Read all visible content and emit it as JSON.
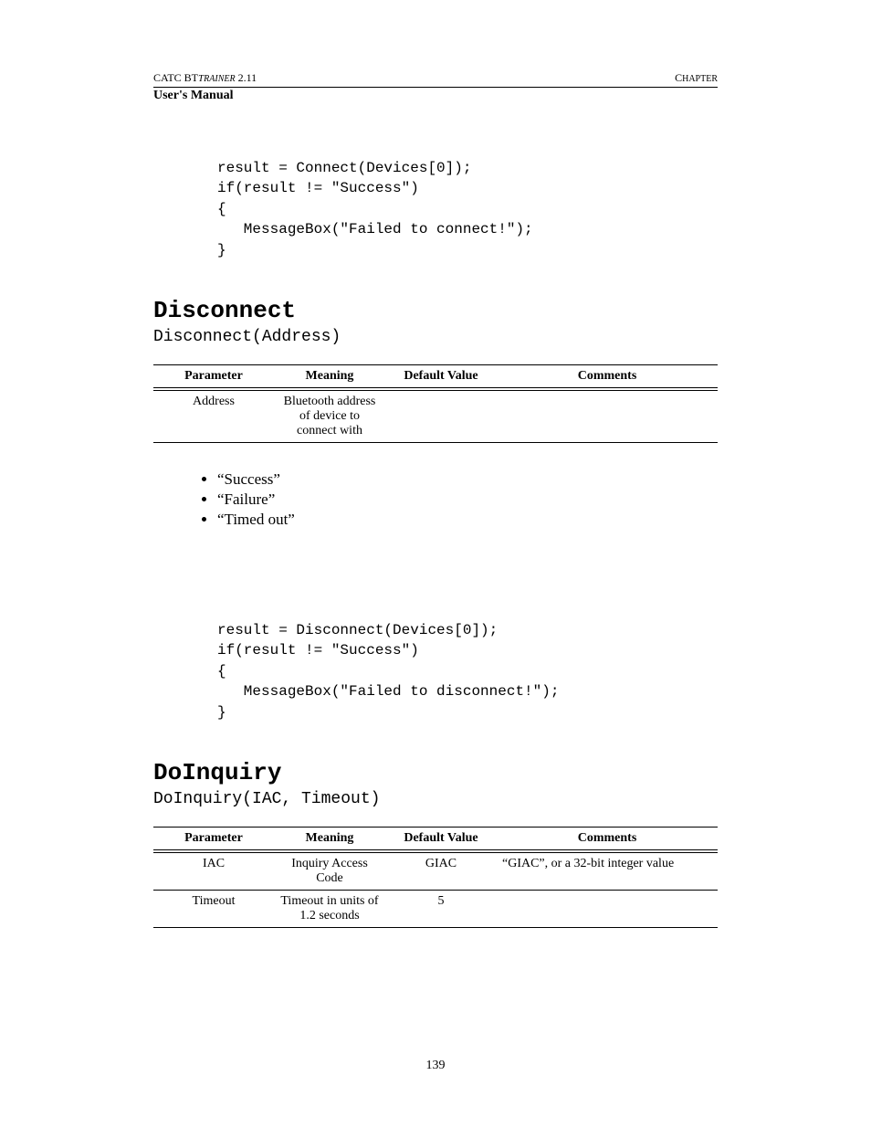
{
  "header": {
    "left": "CATC BTTRAINER 2.11",
    "right": "CHAPTER",
    "sub": "User's Manual"
  },
  "code1": "result = Connect(Devices[0]);\nif(result != \"Success\")\n{\n   MessageBox(\"Failed to connect!\");\n}",
  "section1": {
    "title": "Disconnect",
    "signature": "Disconnect(Address)"
  },
  "table1": {
    "headers": {
      "p": "Parameter",
      "m": "Meaning",
      "d": "Default Value",
      "c": "Comments"
    },
    "rows": [
      {
        "p": "Address",
        "m": "Bluetooth address of device to connect with",
        "d": "",
        "c": ""
      }
    ]
  },
  "returns": [
    "“Success”",
    "“Failure”",
    "“Timed out”"
  ],
  "code2": "result = Disconnect(Devices[0]);\nif(result != \"Success\")\n{\n   MessageBox(\"Failed to disconnect!\");\n}",
  "section2": {
    "title": "DoInquiry",
    "signature": "DoInquiry(IAC, Timeout)"
  },
  "table2": {
    "headers": {
      "p": "Parameter",
      "m": "Meaning",
      "d": "Default Value",
      "c": "Comments"
    },
    "rows": [
      {
        "p": "IAC",
        "m": "Inquiry Access Code",
        "d": "GIAC",
        "c": "“GIAC”, or a 32-bit integer value"
      },
      {
        "p": "Timeout",
        "m": "Timeout in units of 1.2 seconds",
        "d": "5",
        "c": ""
      }
    ]
  },
  "page_number": "139"
}
